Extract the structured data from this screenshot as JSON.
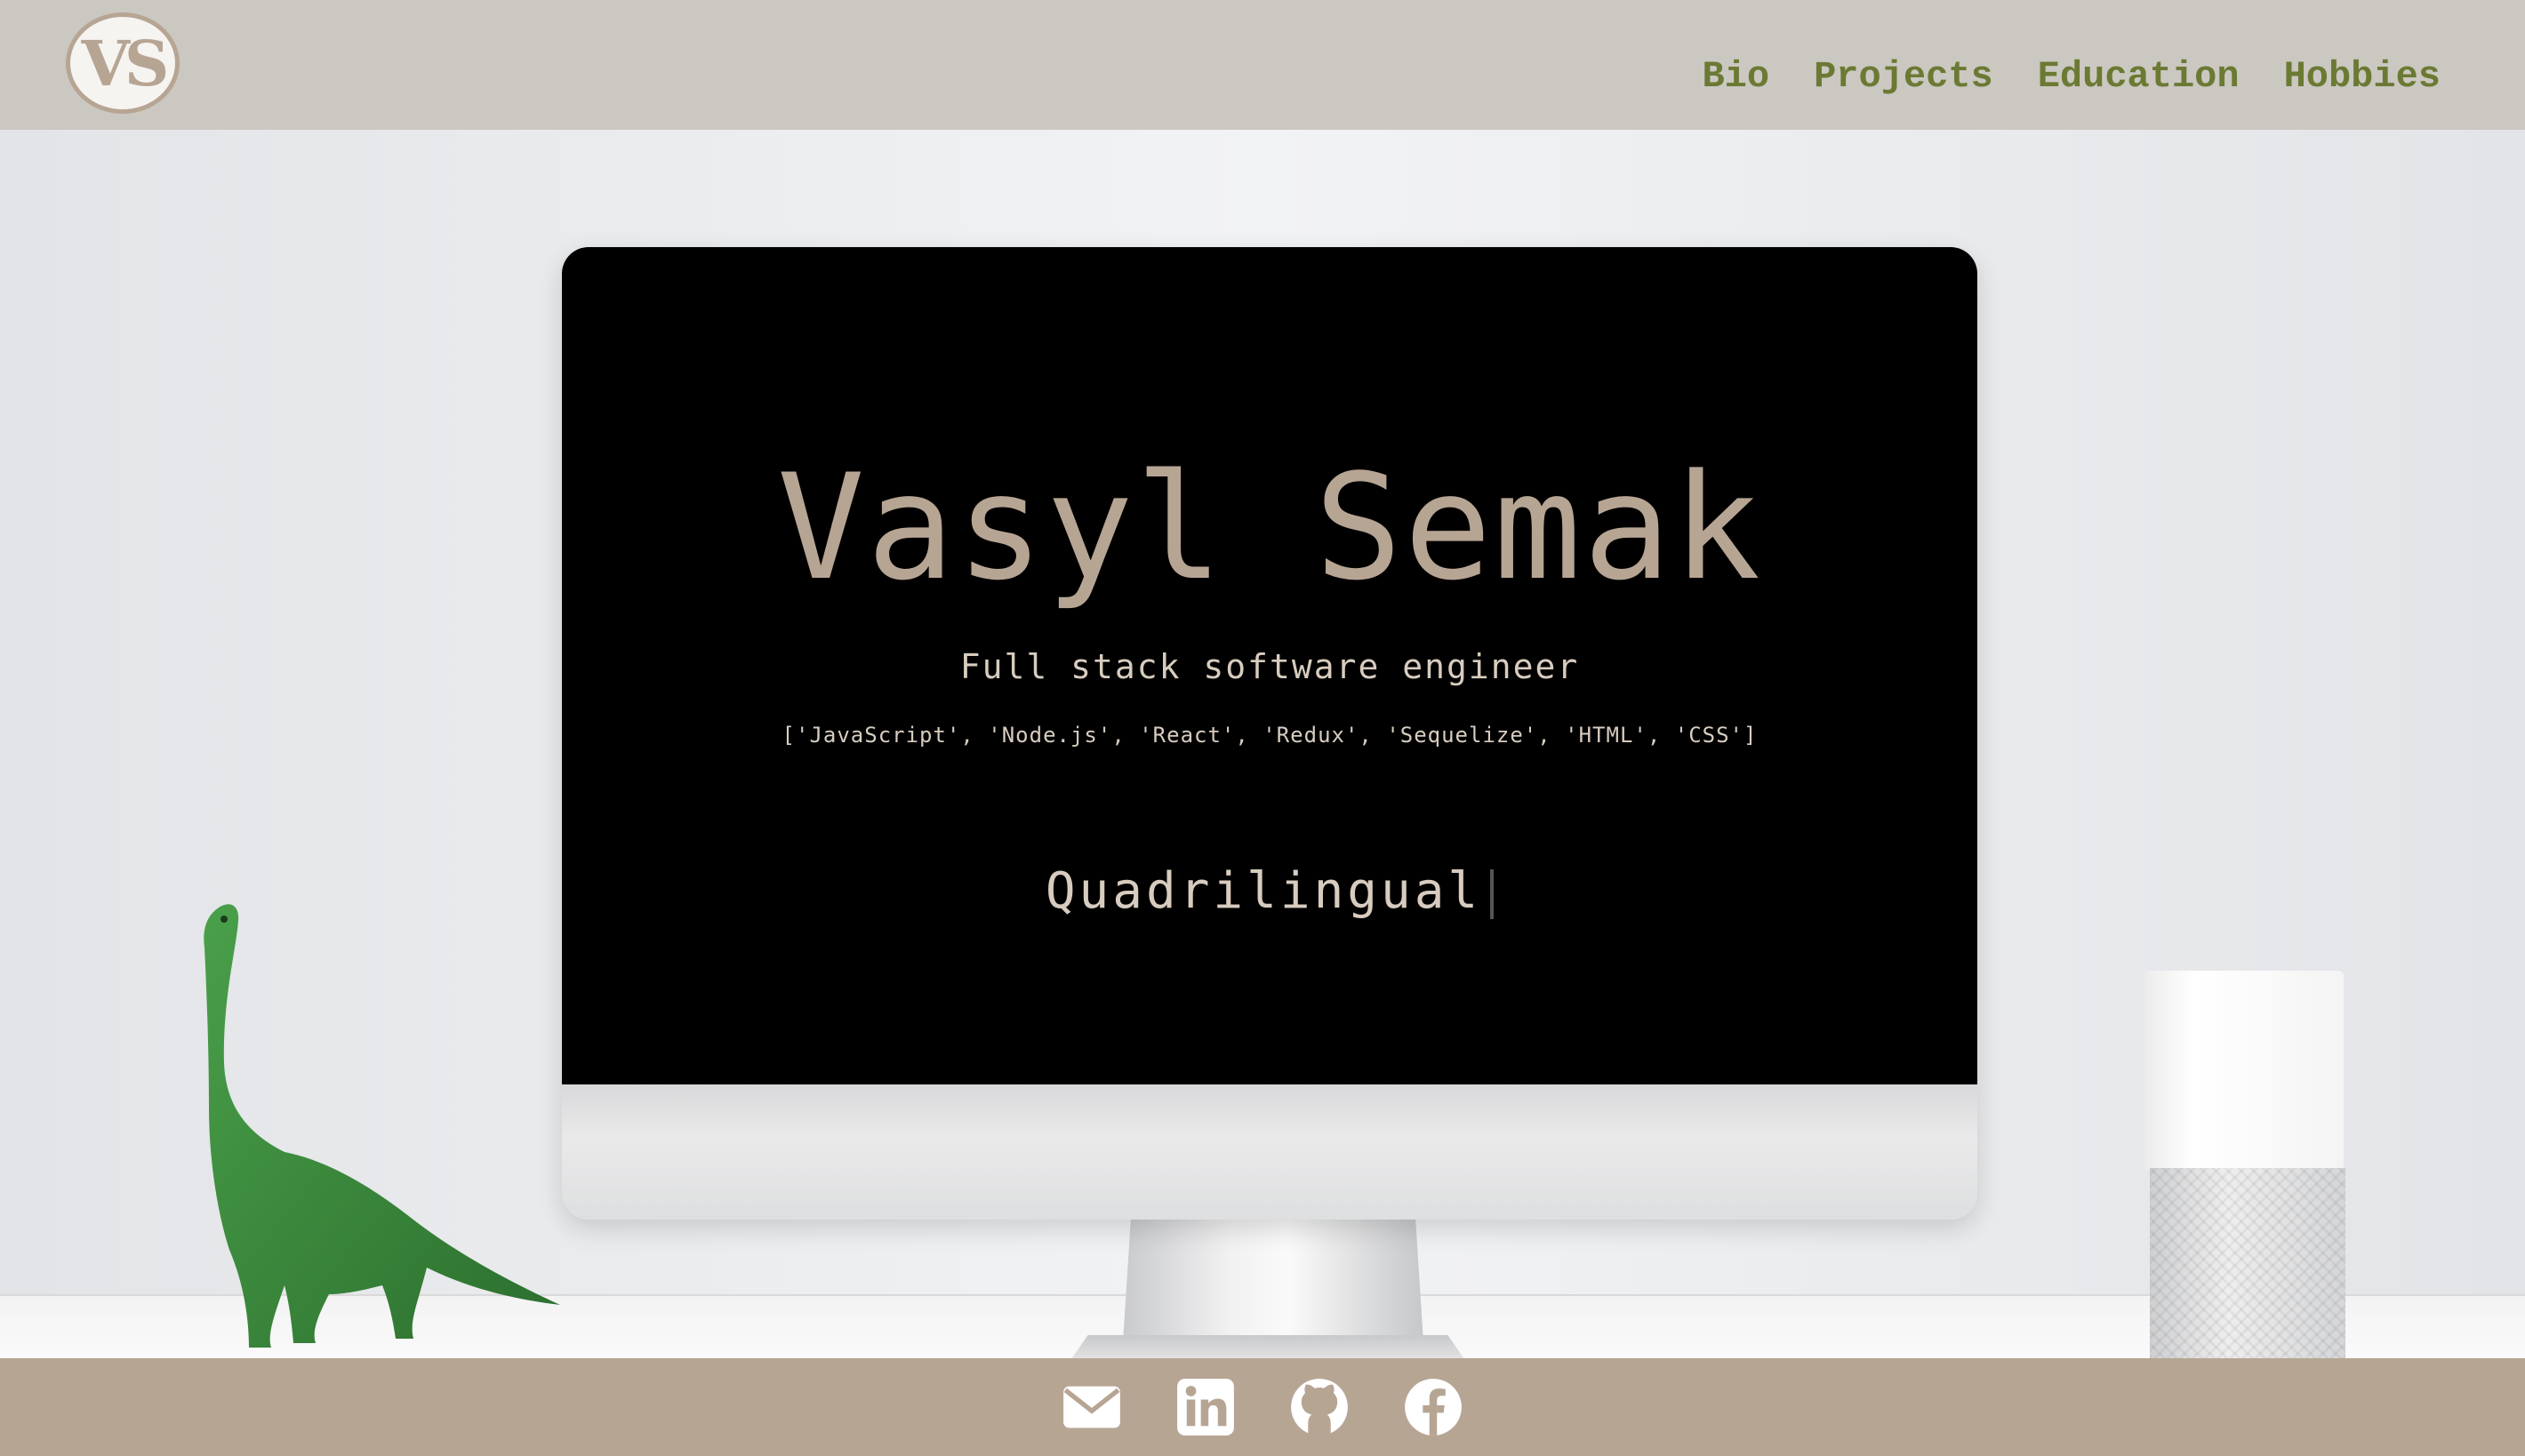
{
  "header": {
    "logo_text": "VS",
    "nav": [
      "Bio",
      "Projects",
      "Education",
      "Hobbies"
    ]
  },
  "hero": {
    "name": "Vasyl Semak",
    "subtitle": "Full stack software engineer",
    "skills": "['JavaScript', 'Node.js', 'React', 'Redux', 'Sequelize', 'HTML', 'CSS']",
    "typed_text": "Quadrilingual"
  },
  "footer": {
    "icons": [
      "email-icon",
      "linkedin-icon",
      "github-icon",
      "facebook-icon"
    ]
  },
  "colors": {
    "header_bg": "#cbc7c1",
    "nav_text": "#6b7a33",
    "accent": "#b7a594",
    "screen_bg": "#000000"
  }
}
